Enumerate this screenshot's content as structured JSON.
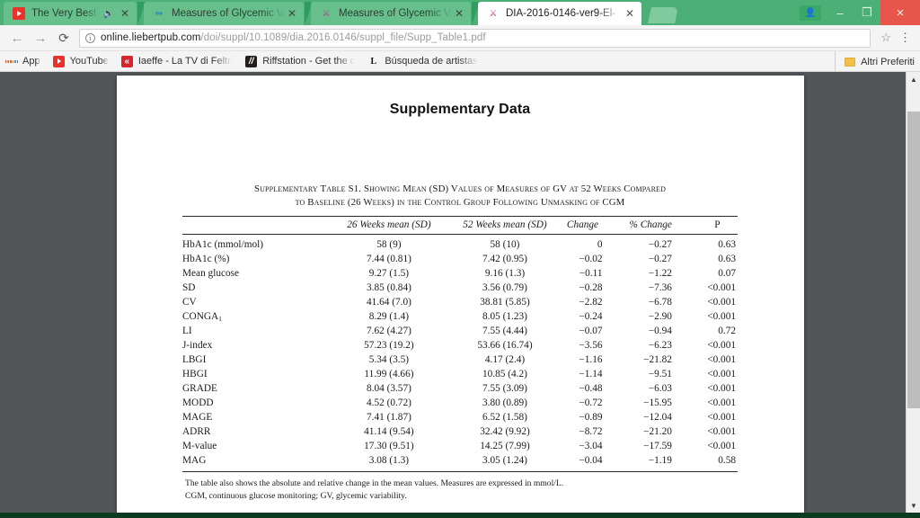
{
  "browser": {
    "tabs": [
      {
        "title": "The Very Best Of Cats",
        "favicon": "youtube-icon",
        "audio": true,
        "active": false
      },
      {
        "title": "Measures of Glycemic Va",
        "favicon": "dna-icon",
        "audio": false,
        "active": false
      },
      {
        "title": "Measures of Glycemic Va",
        "favicon": "article-icon",
        "audio": false,
        "active": false
      },
      {
        "title": "DIA-2016-0146-ver9-El-",
        "favicon": "pdf-icon",
        "audio": false,
        "active": true
      }
    ],
    "window_controls": {
      "profile": "profile-icon",
      "minimize": "–",
      "maximize": "❐",
      "close": "×"
    },
    "toolbar": {
      "back": "←",
      "forward": "→",
      "reload": "⟳",
      "site_info": "i",
      "url_host": "online.liebertpub.com",
      "url_path": "/doi/suppl/10.1089/dia.2016.0146/suppl_file/Supp_Table1.pdf",
      "bookmark_star": "☆",
      "menu": "⋮"
    },
    "bookmarks": [
      {
        "label": "App",
        "icon": "apps-grid-icon"
      },
      {
        "label": "YouTube",
        "icon": "youtube-icon"
      },
      {
        "label": "Iaeffe - La TV di Feltri",
        "icon": "laeffe-icon"
      },
      {
        "label": "Riffstation - Get the c",
        "icon": "riffstation-icon"
      },
      {
        "label": "Búsqueda de artistas",
        "icon": "last-fm-icon"
      }
    ],
    "bookmarks_right": {
      "label": "Altri Preferiti",
      "icon": "folder-icon"
    }
  },
  "document": {
    "title": "Supplementary Data",
    "caption_line1": "Supplementary Table S1. Showing Mean (SD) Values of Measures of GV at 52 Weeks Compared",
    "caption_line2": "to Baseline (26 Weeks) in the Control Group Following Unmasking of CGM",
    "columns": [
      "",
      "26 Weeks mean (SD)",
      "52 Weeks mean (SD)",
      "Change",
      "% Change",
      "P"
    ],
    "rows": [
      {
        "label": "HbA1c (mmol/mol)",
        "w26": "58 (9)",
        "w52": "58 (10)",
        "change": "0",
        "pct": "−0.27",
        "p": "0.63"
      },
      {
        "label": "HbA1c (%)",
        "w26": "7.44 (0.81)",
        "w52": "7.42 (0.95)",
        "change": "−0.02",
        "pct": "−0.27",
        "p": "0.63"
      },
      {
        "label": "Mean glucose",
        "w26": "9.27 (1.5)",
        "w52": "9.16 (1.3)",
        "change": "−0.11",
        "pct": "−1.22",
        "p": "0.07"
      },
      {
        "label": "SD",
        "w26": "3.85 (0.84)",
        "w52": "3.56 (0.79)",
        "change": "−0.28",
        "pct": "−7.36",
        "p": "<0.001"
      },
      {
        "label": "CV",
        "w26": "41.64 (7.0)",
        "w52": "38.81 (5.85)",
        "change": "−2.82",
        "pct": "−6.78",
        "p": "<0.001"
      },
      {
        "label": "CONGA",
        "label_sub": "1",
        "w26": "8.29 (1.4)",
        "w52": "8.05 (1.23)",
        "change": "−0.24",
        "pct": "−2.90",
        "p": "<0.001"
      },
      {
        "label": "LI",
        "w26": "7.62 (4.27)",
        "w52": "7.55 (4.44)",
        "change": "−0.07",
        "pct": "−0.94",
        "p": "0.72"
      },
      {
        "label": "J-index",
        "w26": "57.23 (19.2)",
        "w52": "53.66 (16.74)",
        "change": "−3.56",
        "pct": "−6.23",
        "p": "<0.001"
      },
      {
        "label": "LBGI",
        "w26": "5.34 (3.5)",
        "w52": "4.17 (2.4)",
        "change": "−1.16",
        "pct": "−21.82",
        "p": "<0.001"
      },
      {
        "label": "HBGI",
        "w26": "11.99 (4.66)",
        "w52": "10.85 (4.2)",
        "change": "−1.14",
        "pct": "−9.51",
        "p": "<0.001"
      },
      {
        "label": "GRADE",
        "w26": "8.04 (3.57)",
        "w52": "7.55 (3.09)",
        "change": "−0.48",
        "pct": "−6.03",
        "p": "<0.001"
      },
      {
        "label": "MODD",
        "w26": "4.52 (0.72)",
        "w52": "3.80 (0.89)",
        "change": "−0.72",
        "pct": "−15.95",
        "p": "<0.001"
      },
      {
        "label": "MAGE",
        "w26": "7.41 (1.87)",
        "w52": "6.52 (1.58)",
        "change": "−0.89",
        "pct": "−12.04",
        "p": "<0.001"
      },
      {
        "label": "ADRR",
        "w26": "41.14 (9.54)",
        "w52": "32.42 (9.92)",
        "change": "−8.72",
        "pct": "−21.20",
        "p": "<0.001"
      },
      {
        "label": "M-value",
        "w26": "17.30 (9.51)",
        "w52": "14.25 (7.99)",
        "change": "−3.04",
        "pct": "−17.59",
        "p": "<0.001"
      },
      {
        "label": "MAG",
        "w26": "3.08 (1.3)",
        "w52": "3.05 (1.24)",
        "change": "−0.04",
        "pct": "−1.19",
        "p": "0.58"
      }
    ],
    "footnote_line1": "The table also shows the absolute and relative change in the mean values. Measures are expressed in mmol/L.",
    "footnote_line2": "CGM, continuous glucose monitoring; GV, glycemic variability."
  },
  "scrollbar": {
    "up_arrow": "▲",
    "down_arrow": "▼"
  },
  "colors": {
    "chrome_accent": "#4caf76",
    "viewer_bg": "#525659",
    "close_button": "#e8564b",
    "taskbar": "#0d3b21"
  }
}
